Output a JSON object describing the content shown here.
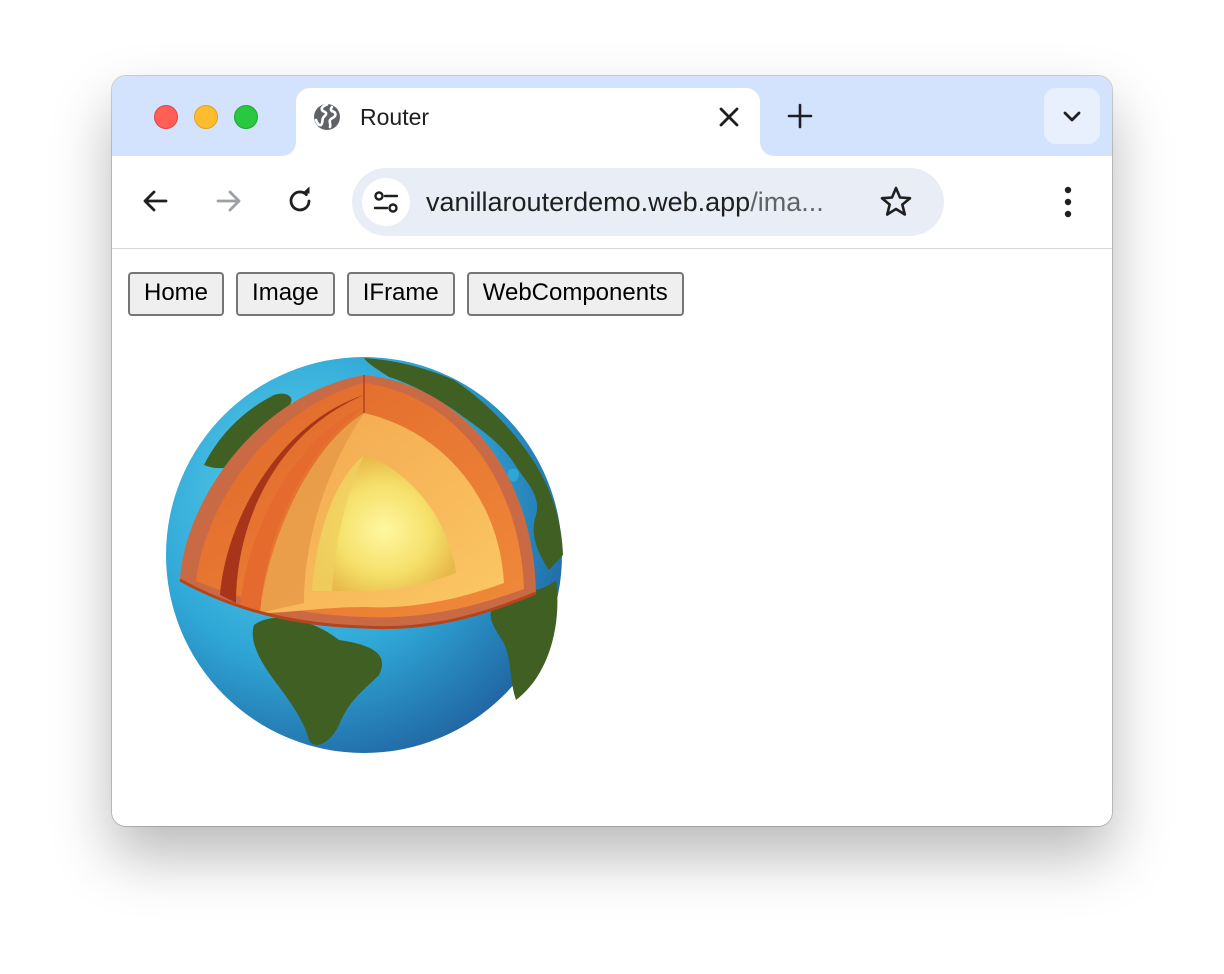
{
  "browser": {
    "tab": {
      "title": "Router",
      "favicon": "globe-icon",
      "close_icon": "close-icon"
    },
    "new_tab_icon": "plus-icon",
    "tab_search_icon": "chevron-down-icon",
    "toolbar": {
      "back_icon": "arrow-left-icon",
      "forward_icon": "arrow-right-icon",
      "reload_icon": "reload-icon",
      "site_info_icon": "tune-icon",
      "url_main": "vanillarouterdemo.web.app",
      "url_rest": "/ima...",
      "bookmark_icon": "star-icon",
      "menu_icon": "more-vertical-icon"
    },
    "colors": {
      "tabstrip": "#d3e3fd",
      "omnibox": "#e9eef6",
      "close_red": "#ff5f57",
      "minimize_yellow": "#febc2e",
      "zoom_green": "#28c840"
    }
  },
  "page": {
    "nav_buttons": [
      {
        "label": "Home"
      },
      {
        "label": "Image"
      },
      {
        "label": "IFrame"
      },
      {
        "label": "WebComponents"
      }
    ],
    "image_subject": "earth-cutaway-layers"
  }
}
